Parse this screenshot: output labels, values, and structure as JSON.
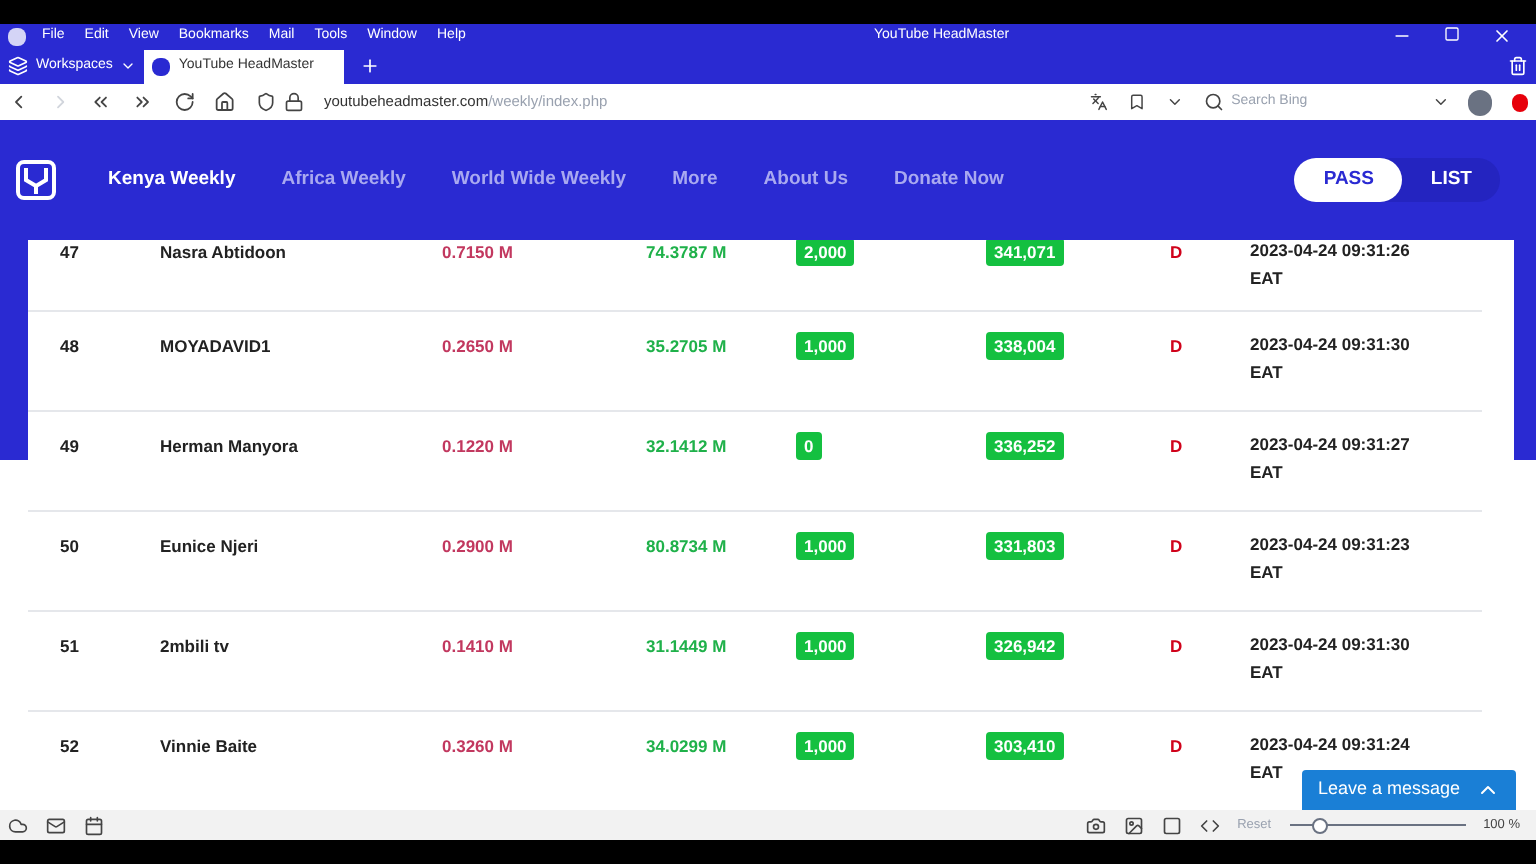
{
  "browser": {
    "menu": [
      "File",
      "Edit",
      "View",
      "Bookmarks",
      "Mail",
      "Tools",
      "Window",
      "Help"
    ],
    "title": "YouTube HeadMaster",
    "workspaces": "Workspaces",
    "tab": {
      "label": "YouTube HeadMaster",
      "selected": true
    },
    "url_host": "youtubeheadmaster.com",
    "url_path": "/weekly/index.php",
    "search": {
      "placeholder": "Search Bing"
    }
  },
  "nav": {
    "items": [
      {
        "label": "Kenya Weekly",
        "selected": true
      },
      {
        "label": "Africa Weekly",
        "selected": false
      },
      {
        "label": "World Wide Weekly",
        "selected": false
      },
      {
        "label": "More",
        "selected": false
      },
      {
        "label": "About Us",
        "selected": false
      },
      {
        "label": "Donate Now",
        "selected": false
      }
    ],
    "toggle": [
      {
        "label": "PASS",
        "selected": true
      },
      {
        "label": "LIST",
        "selected": false
      }
    ]
  },
  "rows": [
    {
      "rank": "47",
      "name": "Nasra Abtidoon",
      "value_1": "0.7150 M",
      "value_2": "74.3787 M",
      "badge_1": "2,000",
      "badge_2": "341,071",
      "flag": "D",
      "time": "2023-04-24 09:31:26",
      "zone": "EAT"
    },
    {
      "rank": "48",
      "name": "MOYADAVID1",
      "value_1": "0.2650 M",
      "value_2": "35.2705 M",
      "badge_1": "1,000",
      "badge_2": "338,004",
      "flag": "D",
      "time": "2023-04-24 09:31:30",
      "zone": "EAT"
    },
    {
      "rank": "49",
      "name": "Herman Manyora",
      "value_1": "0.1220 M",
      "value_2": "32.1412 M",
      "badge_1": "0",
      "badge_2": "336,252",
      "flag": "D",
      "time": "2023-04-24 09:31:27",
      "zone": "EAT"
    },
    {
      "rank": "50",
      "name": "Eunice Njeri",
      "value_1": "0.2900 M",
      "value_2": "80.8734 M",
      "badge_1": "1,000",
      "badge_2": "331,803",
      "flag": "D",
      "time": "2023-04-24 09:31:23",
      "zone": "EAT"
    },
    {
      "rank": "51",
      "name": "2mbili tv",
      "value_1": "0.1410 M",
      "value_2": "31.1449 M",
      "badge_1": "1,000",
      "badge_2": "326,942",
      "flag": "D",
      "time": "2023-04-24 09:31:30",
      "zone": "EAT"
    },
    {
      "rank": "52",
      "name": "Vinnie Baite",
      "value_1": "0.3260 M",
      "value_2": "34.0299 M",
      "badge_1": "1,000",
      "badge_2": "303,410",
      "flag": "D",
      "time": "2023-04-24 09:31:24",
      "zone": "EAT"
    }
  ],
  "chat_button": "Leave a message",
  "status_bar": {
    "reset": "Reset",
    "zoom": {
      "level": 0.17
    },
    "zoom_text": "100 %"
  }
}
